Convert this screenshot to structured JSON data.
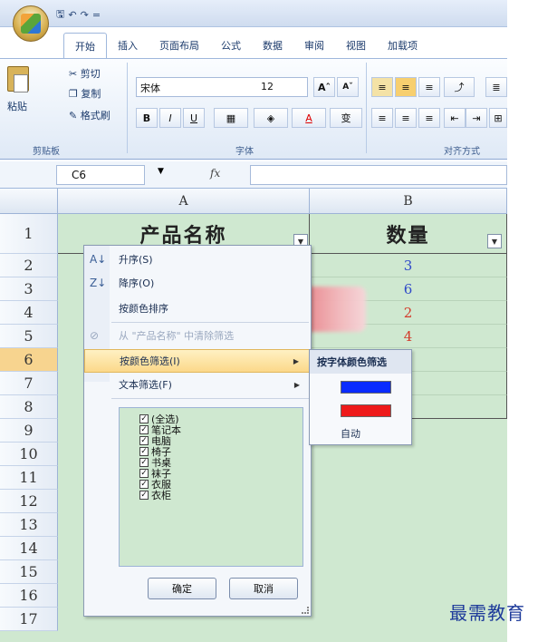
{
  "titlebar": {
    "save_glyph": "🖫",
    "undo_glyph": "↶",
    "redo_glyph": "↷",
    "customize_glyph": "="
  },
  "tabs": [
    "开始",
    "插入",
    "页面布局",
    "公式",
    "数据",
    "审阅",
    "视图",
    "加载项"
  ],
  "ribbon": {
    "paste": "粘贴",
    "cut": "剪切",
    "copy": "复制",
    "format_painter": "格式刷",
    "clipboard_group": "剪贴板",
    "font_name": "宋体",
    "font_size": "12",
    "grow_font": "Aˆ",
    "shrink_font": "Aˇ",
    "bold": "B",
    "italic": "I",
    "underline": "U",
    "phonetic": "变",
    "font_group": "字体",
    "align_group": "对齐方式"
  },
  "formula_bar": {
    "name_box": "C6",
    "fx": "fx"
  },
  "sheet": {
    "columns": [
      "A",
      "B"
    ],
    "rows": [
      "1",
      "2",
      "3",
      "4",
      "5",
      "6",
      "7",
      "8",
      "9",
      "10",
      "11",
      "12",
      "13",
      "14",
      "15",
      "16",
      "17"
    ],
    "header_a": "产品名称",
    "header_b": "数量",
    "b_values": [
      "3",
      "6",
      "2",
      "4"
    ],
    "b_colors": [
      "#2f49c9",
      "#2f49c9",
      "#d33a2a",
      "#d33a2a"
    ]
  },
  "filter_menu": {
    "sort_asc": "升序(S)",
    "sort_desc": "降序(O)",
    "sort_by_color": "按颜色排序",
    "clear_filter": "从 \"产品名称\" 中清除筛选",
    "filter_by_color": "按颜色筛选(I)",
    "text_filter": "文本筛选(F)",
    "items": [
      "(全选)",
      "笔记本",
      "电脑",
      "椅子",
      "书桌",
      "袜子",
      "衣服",
      "衣柜"
    ],
    "ok": "确定",
    "cancel": "取消"
  },
  "submenu": {
    "title": "按字体颜色筛选",
    "colors": [
      "#0a2bff",
      "#ee1a1a"
    ],
    "auto": "自动"
  },
  "watermark": "最需教育"
}
